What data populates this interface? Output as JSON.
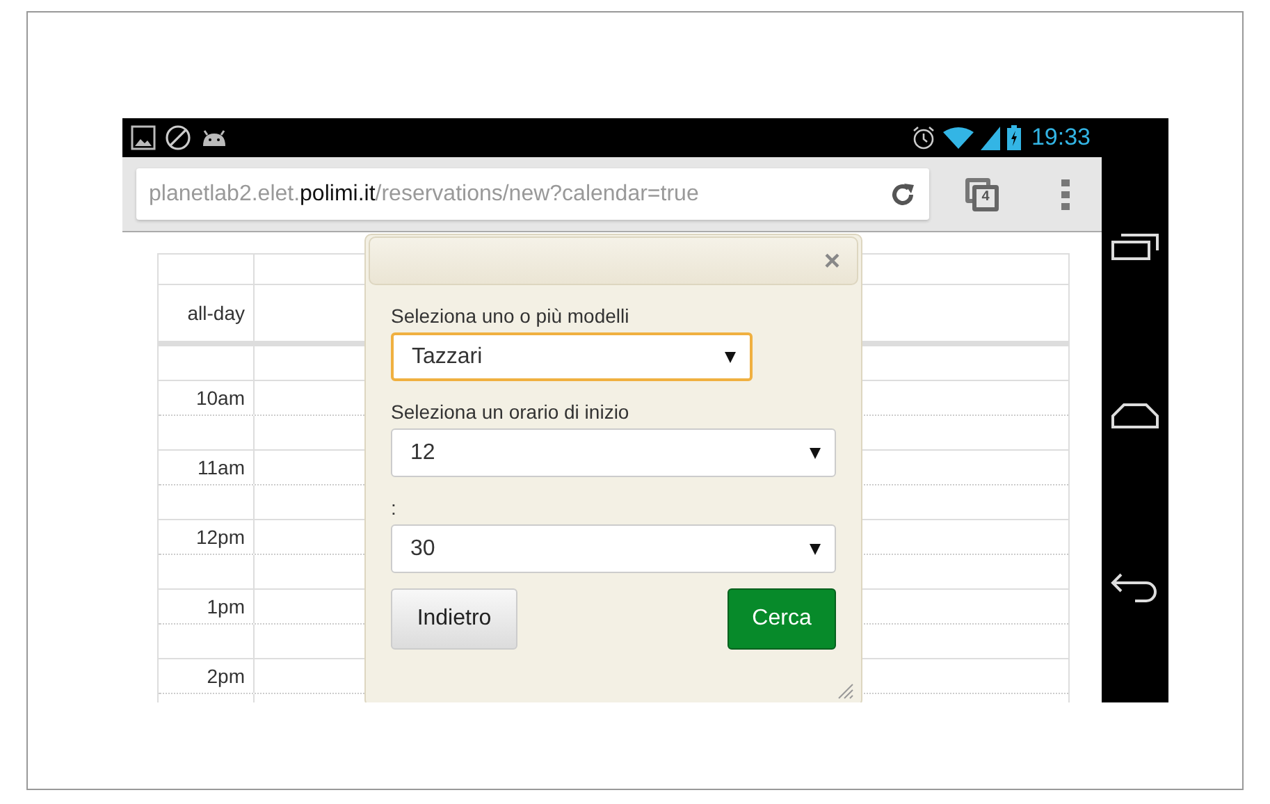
{
  "status_bar": {
    "time": "19:33"
  },
  "browser": {
    "url": [
      {
        "text": "planetlab2.elet.",
        "kind": "plain"
      },
      {
        "text": "polimi.it",
        "kind": "domain"
      },
      {
        "text": "/reservations/new?calendar=true",
        "kind": "plain"
      }
    ],
    "tab_count": "4"
  },
  "calendar": {
    "all_day_label": "all-day",
    "time_labels": [
      "10am",
      "11am",
      "12pm",
      "1pm",
      "2pm"
    ]
  },
  "dialog": {
    "close": "×",
    "fields": [
      {
        "label": "Seleziona uno o più modelli",
        "value": "Tazzari",
        "focused": true
      },
      {
        "label": "Seleziona un orario di inizio",
        "value": "12",
        "focused": false
      },
      {
        "label": ":",
        "value": "30",
        "focused": false
      }
    ],
    "buttons": [
      {
        "label": "Indietro",
        "kind": "secondary"
      },
      {
        "label": "Cerca",
        "kind": "primary"
      }
    ]
  }
}
